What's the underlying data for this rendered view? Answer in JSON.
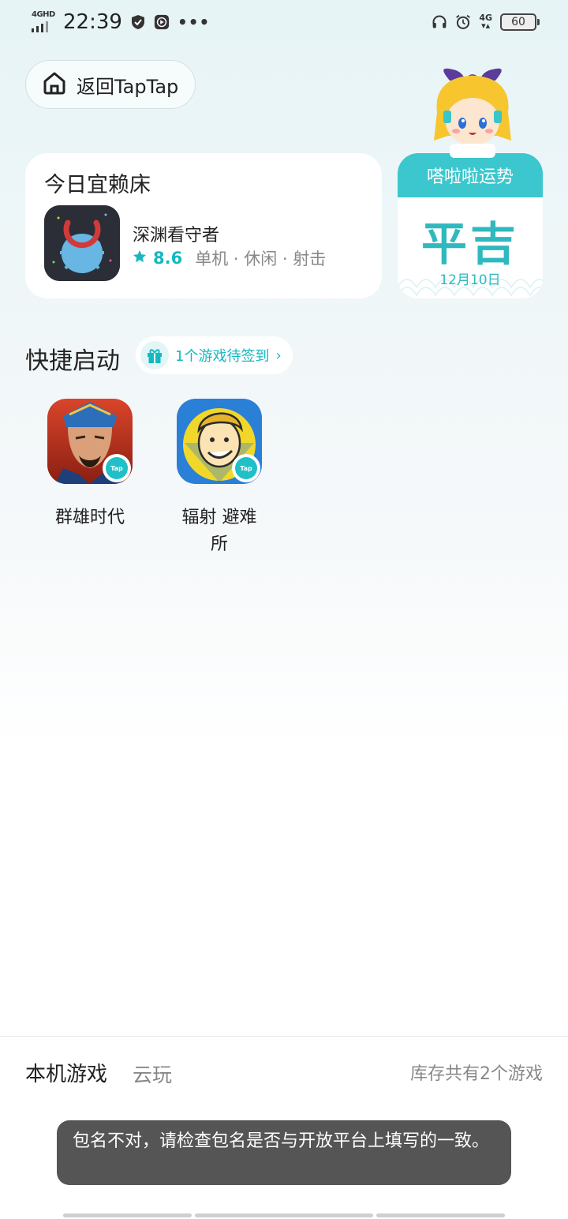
{
  "status_bar": {
    "network_label": "4GHD",
    "time": "22:39",
    "network_right": "4G",
    "battery": "60"
  },
  "back_button": {
    "label": "返回TapTap"
  },
  "today_card": {
    "title": "今日宜赖床",
    "game_name": "深渊看守者",
    "rating": "8.6",
    "tags": "单机 · 休闲 · 射击"
  },
  "fortune_card": {
    "header": "嗒啦啦运势",
    "fortune": "平吉",
    "date": "12月10日"
  },
  "quick_launch": {
    "title": "快捷启动",
    "checkin_pill": "1个游戏待签到",
    "apps": [
      {
        "label": "群雄时代",
        "icon": "three-kingdoms-warrior-icon"
      },
      {
        "label": "辐射 避难所",
        "icon": "vault-boy-icon"
      }
    ],
    "badge_text": "Tap"
  },
  "bottom_tabs": {
    "local": "本机游戏",
    "cloud": "云玩",
    "total": "库存共有2个游戏"
  },
  "toast": {
    "message": "包名不对，请检查包名是否与开放平台上填写的一致。"
  },
  "colors": {
    "accent": "#15b8c0",
    "fortune_header": "#3bc7cd",
    "toast_bg": "#555555"
  }
}
